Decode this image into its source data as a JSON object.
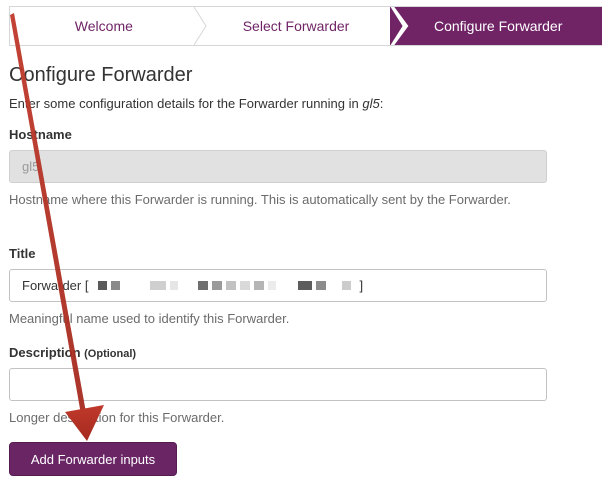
{
  "wizard": {
    "steps": [
      "Welcome",
      "Select Forwarder",
      "Configure Forwarder"
    ],
    "active_step": 2,
    "colors": {
      "accent": "#702466",
      "inactive_text": "#702466"
    }
  },
  "page": {
    "title": "Configure Forwarder",
    "intro_prefix": "Enter some configuration details for the Forwarder running in ",
    "intro_node": "gl5",
    "intro_suffix": ":"
  },
  "form": {
    "hostname": {
      "label": "Hostname",
      "value": "gl5",
      "help": "Hostname where this Forwarder is running. This is automatically sent by the Forwarder."
    },
    "title": {
      "label": "Title",
      "value_prefix": "Forwarder [",
      "value_suffix": "]",
      "help": "Meaningful name used to identify this Forwarder."
    },
    "description": {
      "label": "Description",
      "optional": "(Optional)",
      "value": "",
      "help": "Longer description for this Forwarder."
    }
  },
  "actions": {
    "submit_label": "Add Forwarder inputs"
  },
  "annotation": {
    "arrow_color": "#c0392b",
    "icon": "red-arrow-annotation"
  }
}
